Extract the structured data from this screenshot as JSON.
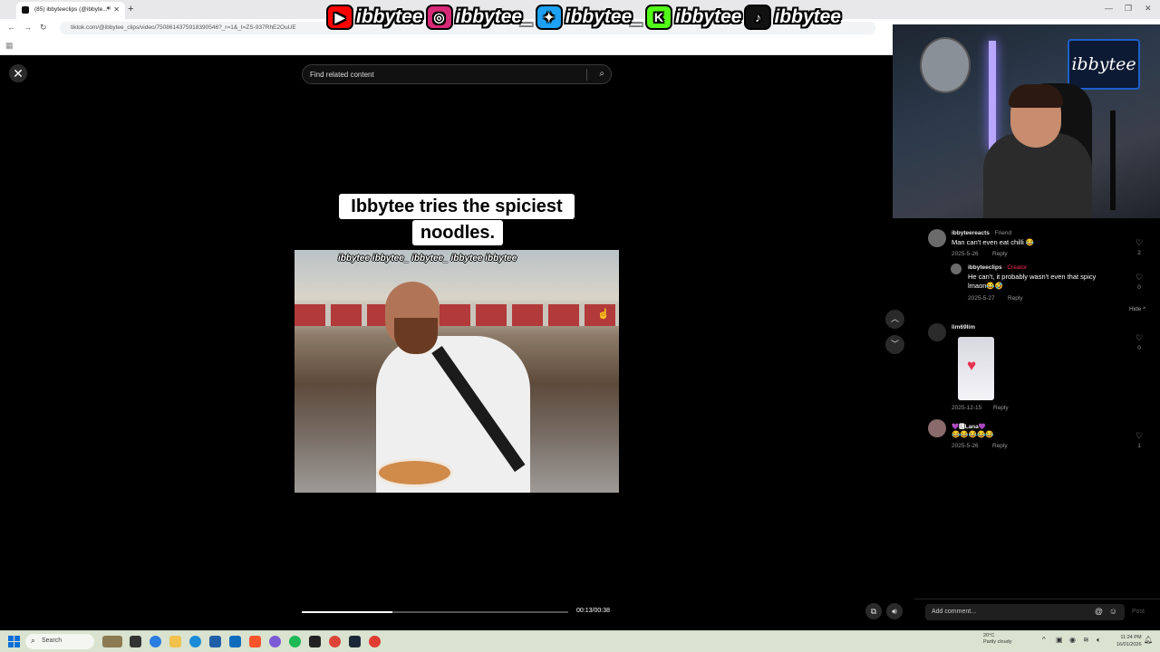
{
  "browser": {
    "tab_title": "(85) ibbyteeclips (@ibbyte...",
    "url": "tiktok.com/@ibbytee_clips/video/7508614375918390546?_r=1&_t=ZS-937RhE2OuUE"
  },
  "banner": {
    "items": [
      {
        "icon": "youtube-icon",
        "handle": "ibbytee",
        "color": "#ff0000",
        "glyph": "▶"
      },
      {
        "icon": "instagram-icon",
        "handle": "ibbytee_",
        "color": "#d62976",
        "glyph": "◎"
      },
      {
        "icon": "twitter-icon",
        "handle": "ibbytee_",
        "color": "#1da1f2",
        "glyph": "✦"
      },
      {
        "icon": "kick-icon",
        "handle": "ibbytee",
        "color": "#53fc18",
        "glyph": "K"
      },
      {
        "icon": "tiktok-icon",
        "handle": "ibbytee",
        "color": "#111111",
        "glyph": "♪"
      }
    ]
  },
  "player": {
    "search_placeholder": "Find related content",
    "caption_line1": "Ibbytee tries the spiciest",
    "caption_line2": "noodles.",
    "watermark": "ibbytee ibbytee_ ibbytee_ ibbytee ibbytee",
    "time": "00:13/00:38",
    "progress_fraction": 0.34
  },
  "webcam": {
    "logo_text": "ibbytee"
  },
  "comments": [
    {
      "user": "ibbyteereacts",
      "tag": "· Friend",
      "text": "Man can't even eat chilli 😂",
      "date": "2025-5-26",
      "reply": "Reply",
      "likes": "2",
      "reply_item": {
        "user": "ibbyteeclips",
        "tag": "· Creator",
        "text_line1": "He can't, it probably wasn't even that spicy",
        "text_line2": "lmaon😂🤣",
        "date": "2025-5-27",
        "reply": "Reply",
        "likes": "0"
      },
      "hide": "Hide ^"
    },
    {
      "user": "lim69lim",
      "date": "2025-12-15",
      "reply": "Reply",
      "likes": "0"
    },
    {
      "user": "💜🅻Lana💜",
      "text": "😂😂😂😂😂",
      "date": "2025-5-26",
      "reply": "Reply",
      "likes": "1"
    }
  ],
  "add_comment": {
    "placeholder": "Add comment...",
    "post": "Post"
  },
  "taskbar": {
    "search": "Search",
    "weather_temp": "20°C",
    "weather_desc": "Partly cloudy",
    "time": "11:24 PM",
    "date": "16/01/2026"
  }
}
